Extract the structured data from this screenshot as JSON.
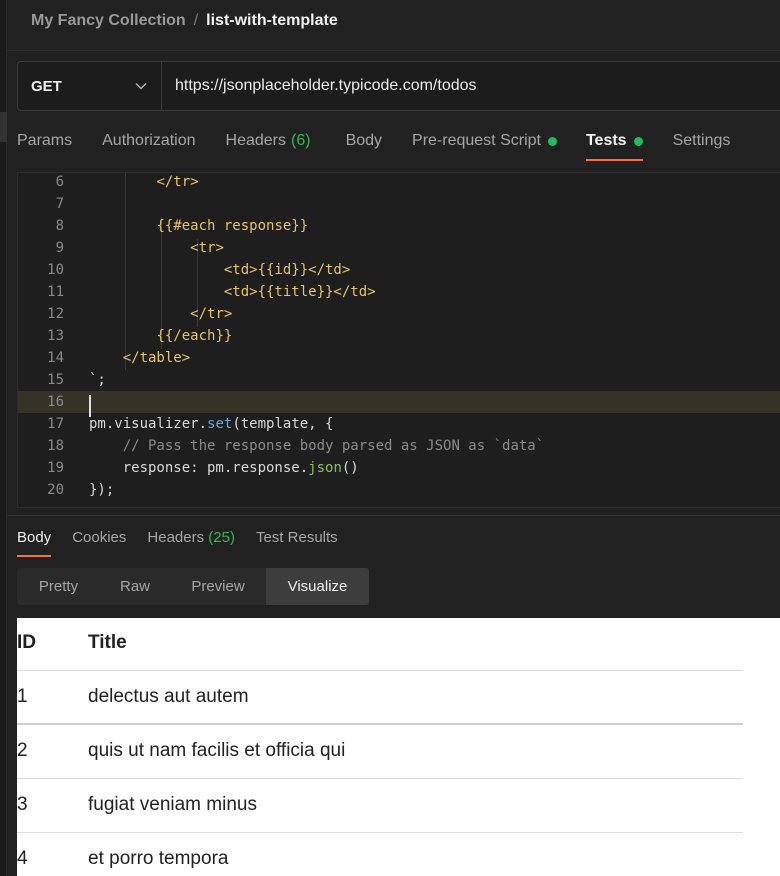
{
  "breadcrumb": {
    "collection": "My Fancy Collection",
    "separator": "/",
    "request": "list-with-template"
  },
  "request": {
    "method": "GET",
    "url": "https://jsonplaceholder.typicode.com/todos"
  },
  "request_tabs": [
    {
      "label": "Params"
    },
    {
      "label": "Authorization"
    },
    {
      "label": "Headers",
      "count": "(6)"
    },
    {
      "label": "Body"
    },
    {
      "label": "Pre-request Script",
      "dot": true
    },
    {
      "label": "Tests",
      "dot": true,
      "active": true
    },
    {
      "label": "Settings"
    }
  ],
  "editor": {
    "lines": [
      {
        "n": "6",
        "text": "        </tr>"
      },
      {
        "n": "7",
        "text": ""
      },
      {
        "n": "8",
        "text": "        {{#each response}}"
      },
      {
        "n": "9",
        "text": "            <tr>"
      },
      {
        "n": "10",
        "text": "                <td>{{id}}</td>"
      },
      {
        "n": "11",
        "text": "                <td>{{title}}</td>"
      },
      {
        "n": "12",
        "text": "            </tr>"
      },
      {
        "n": "13",
        "text": "        {{/each}}"
      },
      {
        "n": "14",
        "text": "    </table>"
      },
      {
        "n": "15",
        "text": "`;"
      },
      {
        "n": "16",
        "text": ""
      },
      {
        "n": "17",
        "text": "pm.visualizer.set(template, {"
      },
      {
        "n": "18",
        "text": "    // Pass the response body parsed as JSON as `data`"
      },
      {
        "n": "19",
        "text": "    response: pm.response.json()"
      },
      {
        "n": "20",
        "text": "});"
      }
    ]
  },
  "response_tabs": [
    {
      "label": "Body",
      "active": true
    },
    {
      "label": "Cookies"
    },
    {
      "label": "Headers",
      "count": "(25)"
    },
    {
      "label": "Test Results"
    }
  ],
  "view_modes": [
    {
      "label": "Pretty"
    },
    {
      "label": "Raw"
    },
    {
      "label": "Preview"
    },
    {
      "label": "Visualize",
      "active": true
    }
  ],
  "visualization": {
    "headers": [
      "ID",
      "Title"
    ],
    "rows": [
      [
        "1",
        "delectus aut autem"
      ],
      [
        "2",
        "quis ut nam facilis et officia qui"
      ],
      [
        "3",
        "fugiat veniam minus"
      ],
      [
        "4",
        "et porro tempora"
      ]
    ]
  },
  "colors": {
    "accent": "#ff6c37",
    "status_green": "#2fb84f",
    "dot_green": "#19c15a",
    "tag_yellow": "#e6c65d",
    "method_blue": "#5aa7e8",
    "func_green": "#8bc34a"
  },
  "icons": {
    "method_dropdown": "chevron-down-icon"
  }
}
